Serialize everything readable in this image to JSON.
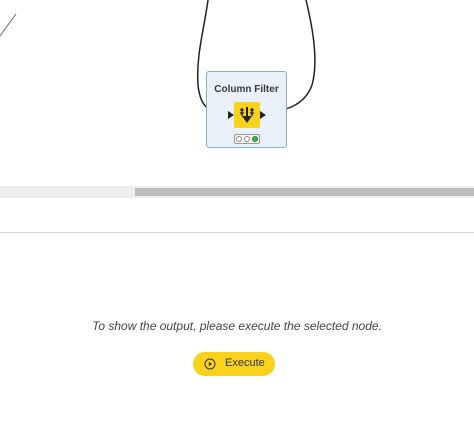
{
  "node": {
    "title": "Column Filter",
    "icon": "column-filter-icon",
    "status": {
      "lights": [
        "empty",
        "empty",
        "green"
      ],
      "active_color": "#3bb54a"
    },
    "accent_color": "#f8d21c"
  },
  "output": {
    "message": "To show the output, please execute the selected node.",
    "execute_label": "Execute",
    "execute_icon": "play-circle-icon"
  },
  "scrollbar": {
    "position_fraction": 0.285
  }
}
